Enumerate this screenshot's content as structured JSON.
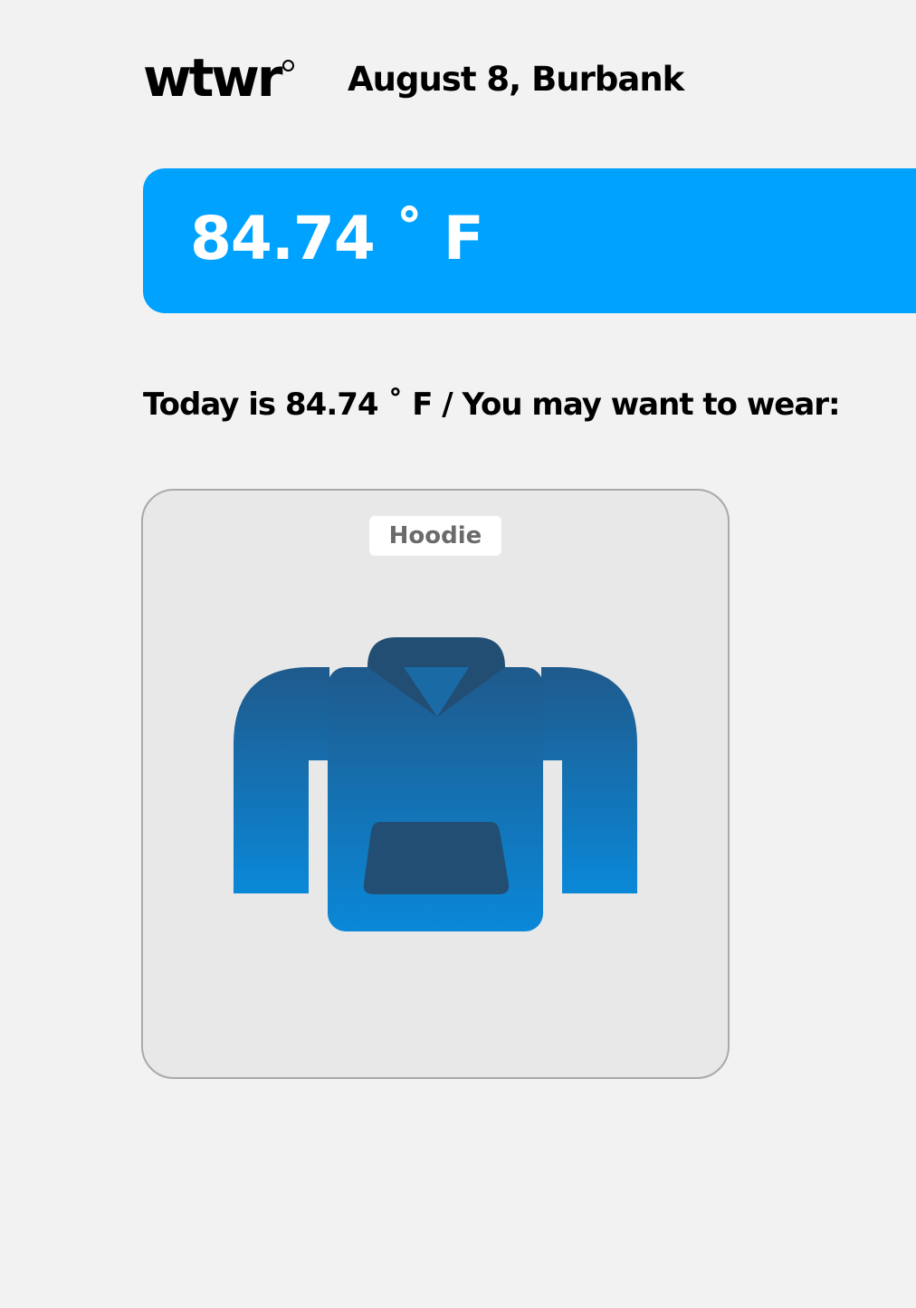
{
  "header": {
    "logo": "wtwr",
    "logo_degree": "°",
    "date_location": "August 8, Burbank"
  },
  "weather": {
    "temperature": "84.74 ˚ F",
    "card_color": "#00a2ff"
  },
  "recommendation": {
    "text": "Today is 84.74 ˚ F / You may want to wear:"
  },
  "items": [
    {
      "name": "Hoodie",
      "icon": "hoodie-icon"
    }
  ]
}
